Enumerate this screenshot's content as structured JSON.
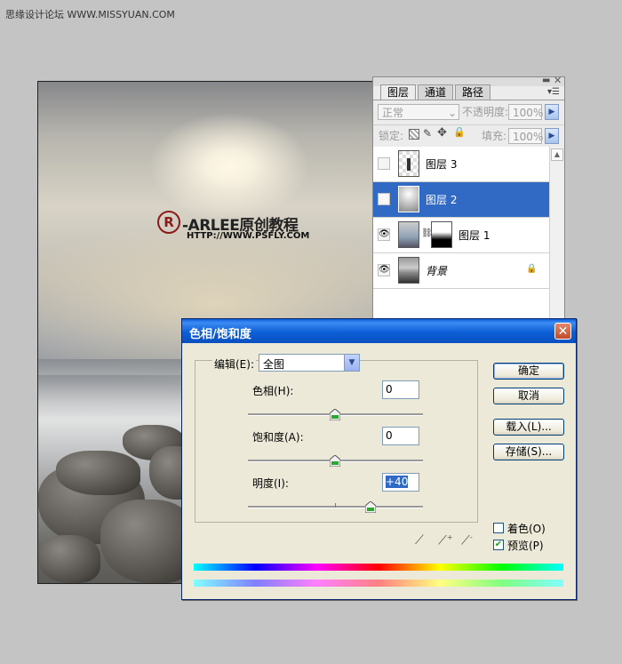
{
  "watermark": "思缘设计论坛 WWW.MISSYUAN.COM",
  "canvas_logo": {
    "symbol": "R",
    "text": "-ARLEE原创教程",
    "url": "HTTP://WWW.PSFLY.COM"
  },
  "layers_panel": {
    "tabs": [
      "图层",
      "通道",
      "路径"
    ],
    "blend_mode": "正常",
    "opacity_label": "不透明度:",
    "opacity_value": "100%",
    "lock_label": "锁定:",
    "fill_label": "填充:",
    "fill_value": "100%",
    "layers": [
      {
        "name": "图层 3",
        "visible": false,
        "selected": false
      },
      {
        "name": "图层 2",
        "visible": true,
        "selected": true
      },
      {
        "name": "图层 1",
        "visible": true,
        "selected": false
      },
      {
        "name": "背景",
        "visible": true,
        "selected": false
      }
    ]
  },
  "dialog": {
    "title": "色相/饱和度",
    "edit_label": "编辑(E):",
    "edit_value": "全图",
    "hue_label": "色相(H):",
    "hue_value": "0",
    "saturation_label": "饱和度(A):",
    "saturation_value": "0",
    "lightness_label": "明度(I):",
    "lightness_value": "+40",
    "buttons": {
      "ok": "确定",
      "cancel": "取消",
      "load": "载入(L)...",
      "save": "存储(S)..."
    },
    "colorize_label": "着色(O)",
    "colorize_checked": false,
    "preview_label": "预览(P)",
    "preview_checked": true
  },
  "colors": {
    "selection": "#316ac5",
    "titlebar": "#0a5fd8",
    "dialog_bg": "#ece9d8"
  }
}
